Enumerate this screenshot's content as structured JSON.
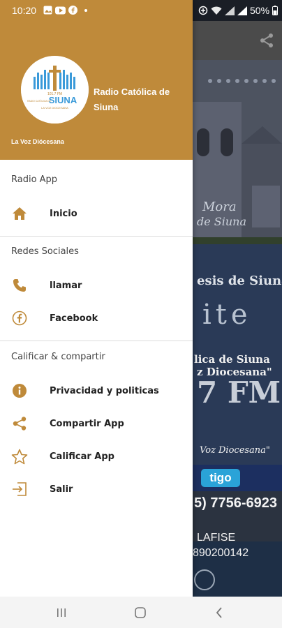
{
  "status_bar": {
    "time": "10:20",
    "battery": "50%"
  },
  "drawer": {
    "header": {
      "station_name": "Radio Católica de Siuna",
      "tagline": "La Voz Diócesana",
      "logo": {
        "frequency": "101.7 FM",
        "top_text": "RADIO CATÓLICA DE",
        "main_text": "SIUNA",
        "bottom_text": "LA VOZ DIOCESANA"
      }
    },
    "sections": [
      {
        "title": "Radio App",
        "items": [
          {
            "label": "Inicio",
            "icon": "home-icon"
          }
        ]
      },
      {
        "title": "Redes Sociales",
        "items": [
          {
            "label": "llamar",
            "icon": "phone-icon"
          },
          {
            "label": "Facebook",
            "icon": "facebook-icon"
          }
        ]
      },
      {
        "title": "Calificar & compartir",
        "items": [
          {
            "label": "Privacidad y politicas",
            "icon": "info-icon"
          },
          {
            "label": "Compartir App",
            "icon": "share-icon"
          },
          {
            "label": "Calificar App",
            "icon": "star-icon"
          },
          {
            "label": "Salir",
            "icon": "exit-icon"
          }
        ]
      }
    ]
  },
  "background_poster": {
    "line1": "Mora",
    "line2": "de Siuna",
    "line3": "esis de Siuna",
    "line4": "ite",
    "line5": "lica de Siuna",
    "line6": "z Diocesana\"",
    "line7": "7 FM",
    "line8": "Voz Diocesana\"",
    "tigo": "tigo",
    "phone": "5) 7756-6923",
    "bank": "LAFISE",
    "account": "890200142"
  },
  "colors": {
    "accent": "#bf8a3a",
    "icon": "#bf8a3a"
  }
}
